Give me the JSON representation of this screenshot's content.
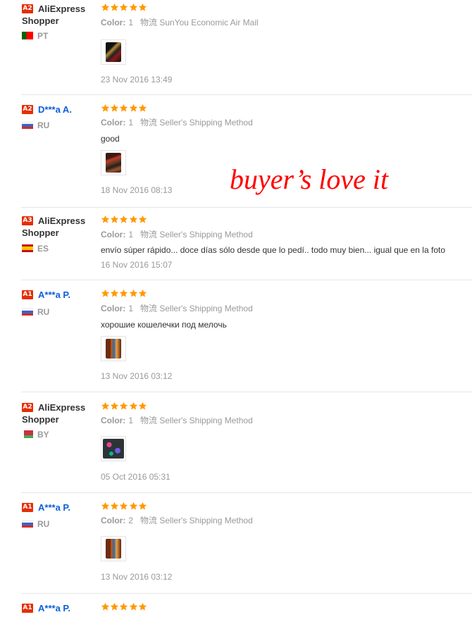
{
  "overlay_text": "buyer’s love it",
  "labels": {
    "color": "Color:",
    "shipping": "物流"
  },
  "reviews": [
    {
      "badge": "A2",
      "name_line1": "AliExpress",
      "name_line2": "Shopper",
      "country": "PT",
      "stars": 5,
      "color_value": "1",
      "shipping": "SunYou Economic Air Mail",
      "text": "",
      "has_photo": true,
      "date": "23 Nov 2016 13:49"
    },
    {
      "badge": "A2",
      "name_line1": "D***a A.",
      "name_line2": "",
      "country": "RU",
      "stars": 5,
      "color_value": "1",
      "shipping": "Seller's Shipping Method",
      "text": "good",
      "has_photo": true,
      "date": "18 Nov 2016 08:13"
    },
    {
      "badge": "A3",
      "name_line1": "AliExpress",
      "name_line2": "Shopper",
      "country": "ES",
      "stars": 5,
      "color_value": "1",
      "shipping": "Seller's Shipping Method",
      "text": "envío súper rápido... doce días sólo desde que lo pedí.. todo muy bien... igual que en la foto",
      "has_photo": false,
      "date": "16 Nov 2016 15:07"
    },
    {
      "badge": "A1",
      "name_line1": "A***a P.",
      "name_line2": "",
      "country": "RU",
      "stars": 5,
      "color_value": "1",
      "shipping": "Seller's Shipping Method",
      "text": "хорошие кошелечки под мелочь",
      "has_photo": true,
      "date": "13 Nov 2016 03:12"
    },
    {
      "badge": "A2",
      "name_line1": "AliExpress",
      "name_line2": "Shopper",
      "country": "BY",
      "stars": 5,
      "color_value": "1",
      "shipping": "Seller's Shipping Method",
      "text": "",
      "has_photo": true,
      "date": "05 Oct 2016 05:31"
    },
    {
      "badge": "A1",
      "name_line1": "A***a P.",
      "name_line2": "",
      "country": "RU",
      "stars": 5,
      "color_value": "2",
      "shipping": "Seller's Shipping Method",
      "text": "",
      "has_photo": true,
      "date": "13 Nov 2016 03:12"
    },
    {
      "badge": "A1",
      "name_line1": "A***a P.",
      "name_line2": "",
      "country": "",
      "stars": 5,
      "color_value": "",
      "shipping": "",
      "text": "",
      "has_photo": false,
      "date": ""
    }
  ],
  "colors": {
    "badge": "#e62e04",
    "star": "#ff9900",
    "anon_name": "#0b5ed7",
    "muted": "#999999",
    "overlay": "#ff0000"
  }
}
